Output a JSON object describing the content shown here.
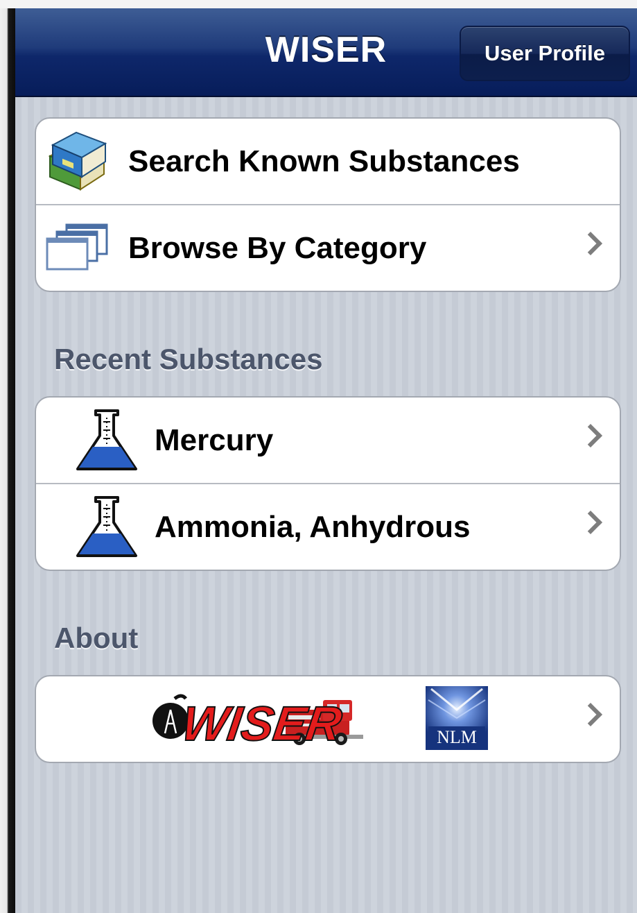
{
  "navbar": {
    "title": "WISER",
    "user_profile_label": "User Profile"
  },
  "main_menu": {
    "items": [
      {
        "label": "Search Known Substances",
        "icon": "books-icon",
        "has_chevron": false
      },
      {
        "label": "Browse By Category",
        "icon": "stacked-windows-icon",
        "has_chevron": true
      }
    ]
  },
  "recent": {
    "header": "Recent Substances",
    "items": [
      {
        "label": "Mercury",
        "icon": "flask-icon"
      },
      {
        "label": "Ammonia, Anhydrous",
        "icon": "flask-icon"
      }
    ]
  },
  "about": {
    "header": "About",
    "logos": {
      "wiser_logo_text": "WISER",
      "nlm_logo_text": "NLM"
    }
  },
  "colors": {
    "navbar": "#0e276a",
    "background_stripes": "#c6ccd6",
    "section_header": "#4c566b",
    "chevron": "#7d7d7d",
    "flask_liquid": "#2a5fc4",
    "wiser_logo_red": "#e31c1c"
  }
}
